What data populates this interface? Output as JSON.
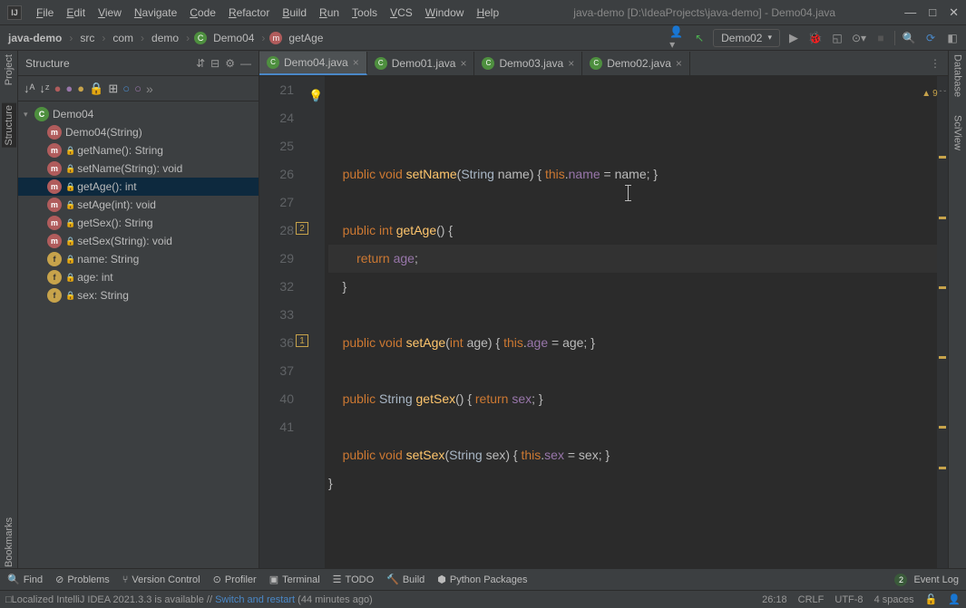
{
  "title": "java-demo [D:\\IdeaProjects\\java-demo] - Demo04.java",
  "menu": [
    "File",
    "Edit",
    "View",
    "Navigate",
    "Code",
    "Refactor",
    "Build",
    "Run",
    "Tools",
    "VCS",
    "Window",
    "Help"
  ],
  "breadcrumb": {
    "project": "java-demo",
    "parts": [
      "src",
      "com",
      "demo"
    ],
    "class": "Demo04",
    "method": "getAge"
  },
  "runConfig": "Demo02",
  "leftTools": [
    "Project",
    "Structure",
    "Bookmarks"
  ],
  "rightTools": [
    "Database",
    "SciView"
  ],
  "structure": {
    "title": "Structure",
    "root": "Demo04",
    "members": [
      {
        "icon": "m",
        "label": "Demo04(String)",
        "locked": false
      },
      {
        "icon": "m",
        "label": "getName(): String",
        "locked": true
      },
      {
        "icon": "m",
        "label": "setName(String): void",
        "locked": true
      },
      {
        "icon": "m",
        "label": "getAge(): int",
        "locked": true,
        "sel": true
      },
      {
        "icon": "m",
        "label": "setAge(int): void",
        "locked": true
      },
      {
        "icon": "m",
        "label": "getSex(): String",
        "locked": true
      },
      {
        "icon": "m",
        "label": "setSex(String): void",
        "locked": true
      },
      {
        "icon": "f",
        "label": "name: String",
        "locked": true
      },
      {
        "icon": "f",
        "label": "age: int",
        "locked": true
      },
      {
        "icon": "f",
        "label": "sex: String",
        "locked": true
      }
    ]
  },
  "tabs": [
    {
      "label": "Demo04.java",
      "active": true
    },
    {
      "label": "Demo01.java",
      "active": false
    },
    {
      "label": "Demo03.java",
      "active": false
    },
    {
      "label": "Demo02.java",
      "active": false
    }
  ],
  "code": {
    "lines": [
      {
        "n": 21,
        "html": "    <span class='k'>public</span> <span class='k'>void</span> <span class='id'>setName</span>(<span class='t'>String</span> name) { <span class='k'>this</span>.<span class='fld'>name</span> = name; }"
      },
      {
        "n": 24,
        "html": ""
      },
      {
        "n": 25,
        "html": "    <span class='k'>public</span> <span class='k'>int</span> <span class='id'>getAge</span>() {"
      },
      {
        "n": 26,
        "html": "        <span class='k'>return</span> <span class='fld'>age</span>;",
        "bulb": true,
        "cur": true
      },
      {
        "n": 27,
        "html": "    }"
      },
      {
        "n": 28,
        "html": "",
        "mark": "2"
      },
      {
        "n": 29,
        "html": "    <span class='k'>public</span> <span class='k'>void</span> <span class='id'>setAge</span>(<span class='k'>int</span> age) { <span class='k'>this</span>.<span class='fld'>age</span> = age; }"
      },
      {
        "n": 32,
        "html": ""
      },
      {
        "n": 33,
        "html": "    <span class='k'>public</span> <span class='t'>String</span> <span class='id'>getSex</span>() { <span class='k'>return</span> <span class='fld'>sex</span>; }"
      },
      {
        "n": 36,
        "html": "",
        "mark": "1"
      },
      {
        "n": 37,
        "html": "    <span class='k'>public</span> <span class='k'>void</span> <span class='id'>setSex</span>(<span class='t'>String</span> sex) { <span class='k'>this</span>.<span class='fld'>sex</span> = sex; }"
      },
      {
        "n": 40,
        "html": "}"
      },
      {
        "n": 41,
        "html": ""
      }
    ],
    "warnings": "9"
  },
  "bottom": [
    "Find",
    "Problems",
    "Version Control",
    "Profiler",
    "Terminal",
    "TODO",
    "Build",
    "Python Packages"
  ],
  "eventLog": {
    "count": "2",
    "label": "Event Log"
  },
  "status": {
    "msg_pre": "Localized IntelliJ IDEA 2021.3.3 is available // ",
    "msg_link": "Switch and restart",
    "msg_post": " (44 minutes ago)",
    "pos": "26:18",
    "eol": "CRLF",
    "enc": "UTF-8",
    "indent": "4 spaces"
  }
}
